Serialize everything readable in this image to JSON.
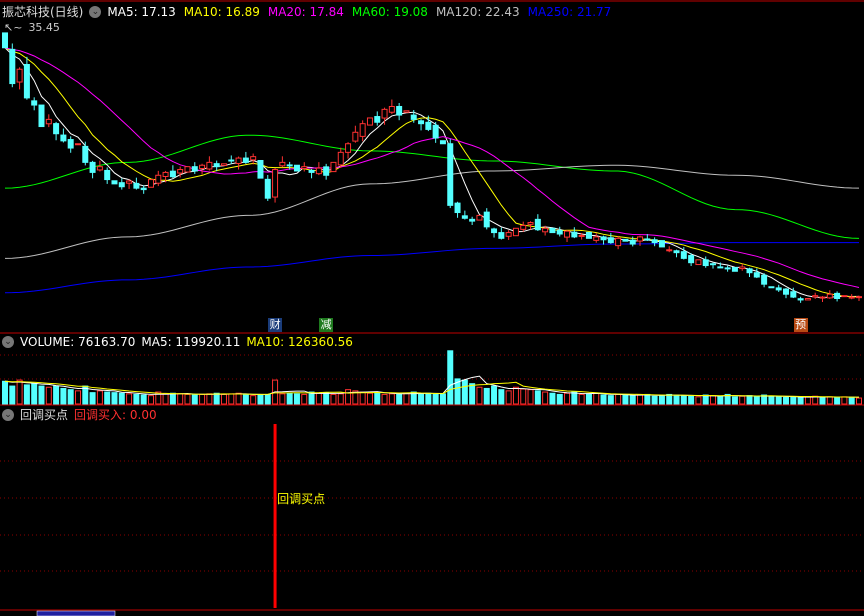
{
  "header": {
    "stock_name": "振芯科技(日线)",
    "ma_labels": [
      {
        "text": "MA5: 17.13",
        "color": "#ffffff"
      },
      {
        "text": "MA10: 16.89",
        "color": "#ffff00"
      },
      {
        "text": "MA20: 17.84",
        "color": "#ff00ff"
      },
      {
        "text": "MA60: 19.08",
        "color": "#00ff00"
      },
      {
        "text": "MA120: 22.43",
        "color": "#c0c0c0"
      },
      {
        "text": "MA250: 21.77",
        "color": "#0000ff"
      }
    ],
    "high_label": "35.45"
  },
  "events": [
    {
      "text": "财",
      "bg": "#1a3c7a"
    },
    {
      "text": "减",
      "bg": "#1e7a1e"
    },
    {
      "text": "预",
      "bg": "#b84a14"
    }
  ],
  "volume_header": {
    "volume": "VOLUME: 76163.70",
    "ma5": "MA5: 119920.11",
    "ma10": "MA10: 126360.56"
  },
  "indicator_header": {
    "name": "回调买点",
    "value": "回调买入: 0.00"
  },
  "signal_label": "回调买点",
  "colors": {
    "up": "#ff3232",
    "down": "#54ffff",
    "grid": "#8b0000",
    "signal": "#ff0000"
  },
  "chart_data": {
    "type": "candlestick",
    "price_range": [
      15.5,
      36.0
    ],
    "closes": [
      34.5,
      32,
      33,
      31,
      30.5,
      29,
      29.5,
      28.5,
      28,
      27.5,
      27.8,
      26.5,
      25.8,
      26.2,
      25.3,
      25,
      24.8,
      25.2,
      24.7,
      24.6,
      25.3,
      25.6,
      25.8,
      25.5,
      26,
      26.2,
      25.9,
      26.3,
      26.5,
      26.2,
      26.4,
      26.6,
      26.8,
      26.5,
      26.9,
      25.4,
      24,
      26,
      26.5,
      26.3,
      25.9,
      26.2,
      25.8,
      26.1,
      25.6,
      26.5,
      27.2,
      27.8,
      28.6,
      29.2,
      29.6,
      29.3,
      30.2,
      30.4,
      29.8,
      30.1,
      29.5,
      29.2,
      28.8,
      28.2,
      27.8,
      23.5,
      23,
      22.6,
      22.4,
      22.8,
      22,
      21.6,
      21.2,
      21.6,
      21.9,
      22.1,
      22.3,
      21.8,
      21.9,
      21.6,
      21.5,
      21.7,
      21.3,
      21.4,
      21.2,
      21.3,
      21.1,
      20.9,
      21.2,
      21,
      20.8,
      21.3,
      21.1,
      20.9,
      20.6,
      20.4,
      20.2,
      19.8,
      19.5,
      19.7,
      19.3,
      19.4,
      19.2,
      19.1,
      18.9,
      19.2,
      18.8,
      18.5,
      18,
      17.8,
      17.6,
      17.3,
      17.1,
      16.9,
      17.0,
      17.2,
      17.1,
      17.3,
      17.0,
      17.2,
      17.1,
      17.13
    ],
    "volumes": [
      190,
      150,
      200,
      160,
      170,
      150,
      140,
      150,
      130,
      120,
      110,
      150,
      95,
      110,
      100,
      95,
      90,
      85,
      80,
      75,
      70,
      100,
      85,
      90,
      85,
      80,
      75,
      80,
      85,
      90,
      80,
      85,
      90,
      80,
      70,
      75,
      80,
      200,
      85,
      90,
      85,
      80,
      100,
      90,
      95,
      80,
      85,
      120,
      110,
      100,
      90,
      95,
      80,
      85,
      80,
      90,
      100,
      85,
      90,
      80,
      85,
      445,
      210,
      200,
      170,
      140,
      130,
      150,
      120,
      110,
      140,
      125,
      120,
      110,
      100,
      90,
      80,
      90,
      100,
      80,
      85,
      90,
      75,
      70,
      80,
      75,
      70,
      75,
      80,
      65,
      70,
      80,
      75,
      70,
      65,
      60,
      75,
      70,
      65,
      80,
      60,
      65,
      70,
      60,
      75,
      65,
      60,
      55,
      60,
      55,
      60,
      65,
      55,
      60,
      55,
      60,
      55,
      50
    ],
    "volume_range": [
      0,
      460
    ],
    "long_ma": [
      {
        "name": "MA60",
        "color": "#00ff00",
        "samples": [
          24.7,
          26.5,
          28.4,
          27.3,
          26.6,
          25.9,
          23.2,
          21.2
        ]
      },
      {
        "name": "MA120",
        "color": "#c0c0c0",
        "samples": [
          19.8,
          21.3,
          22.8,
          25.0,
          25.9,
          26.3,
          25.6,
          24.7
        ]
      },
      {
        "name": "MA250",
        "color": "#0000ff",
        "samples": [
          17.4,
          18.3,
          19.2,
          20.0,
          20.5,
          20.8,
          20.9,
          20.9
        ]
      }
    ],
    "signal_index": 37,
    "event_indices": [
      37,
      44,
      109
    ]
  }
}
